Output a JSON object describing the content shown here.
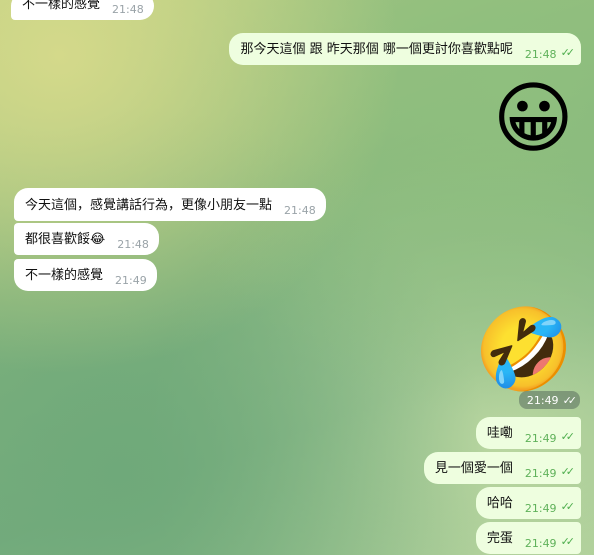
{
  "messages": {
    "m0": {
      "text": "不一樣的感覺",
      "time": "21:48"
    },
    "m1": {
      "text": "那今天這個 跟 昨天那個  哪一個更討你喜歡點呢",
      "time": "21:48"
    },
    "m2": {
      "emoji": "😀"
    },
    "m3": {
      "text": "今天這個，感覺講話行為，更像小朋友一點",
      "time": "21:48"
    },
    "m4": {
      "text": "都很喜歡餒😂",
      "time": "21:48"
    },
    "m5": {
      "text": "不一樣的感覺",
      "time": "21:49"
    },
    "m6": {
      "emoji": "🤣",
      "time": "21:49"
    },
    "m7": {
      "text": "哇嘞",
      "time": "21:49"
    },
    "m8": {
      "text": "見一個愛一個",
      "time": "21:49"
    },
    "m9": {
      "text": "哈哈",
      "time": "21:49"
    },
    "m10": {
      "text": "完蛋",
      "time": "21:49"
    }
  },
  "colors": {
    "incoming": "#ffffff",
    "outgoing": "#eefedf",
    "read_check": "#4fae4e"
  },
  "icons": {
    "read_receipt": "double-check-icon"
  }
}
